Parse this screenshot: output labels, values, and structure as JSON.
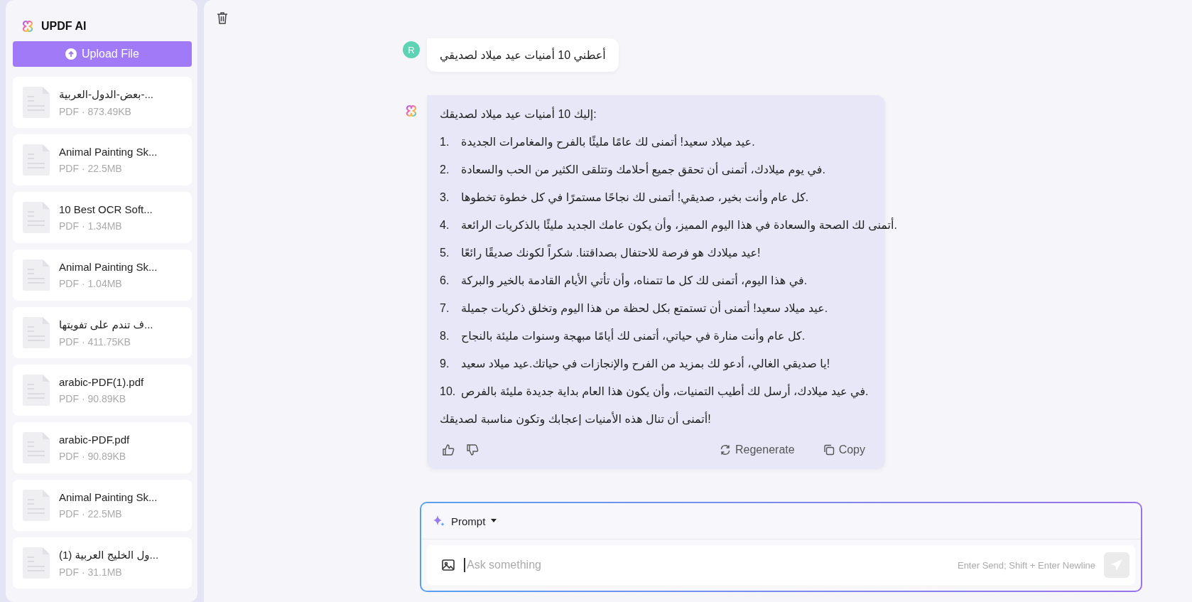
{
  "app": {
    "title": "UPDF AI",
    "upload_button": "Upload File"
  },
  "files": [
    {
      "name": "...-بعض-الدول-العربية",
      "meta": "PDF · 873.49KB"
    },
    {
      "name": "Animal Painting Sk...",
      "meta": "PDF · 22.5MB"
    },
    {
      "name": "10 Best OCR Soft...",
      "meta": "PDF · 1.34MB"
    },
    {
      "name": "Animal Painting Sk...",
      "meta": "PDF · 1.04MB"
    },
    {
      "name": "...ف تندم على تفويتها",
      "meta": "PDF · 411.75KB"
    },
    {
      "name": "arabic-PDF(1).pdf",
      "meta": "PDF · 90.89KB"
    },
    {
      "name": "arabic-PDF.pdf",
      "meta": "PDF · 90.89KB"
    },
    {
      "name": "Animal Painting Sk...",
      "meta": "PDF · 22.5MB"
    },
    {
      "name": "...ول الخليج العربية (1)",
      "meta": "PDF · 31.1MB"
    }
  ],
  "messages": [
    {
      "kind": "user",
      "avatar": "R",
      "text": "أعطني 10 أمنيات عيد ميلاد لصديقي"
    },
    {
      "kind": "assistant",
      "intro": "إليك 10 أمنيات عيد ميلاد لصديقك:",
      "items": [
        {
          "number": "1.",
          "text": "عيد ميلاد سعيد! أتمنى لك عامًا مليئًا بالفرح والمغامرات الجديدة."
        },
        {
          "number": "2.",
          "text": "في يوم ميلادك، أتمنى أن تحقق جميع أحلامك وتتلقى الكثير من الحب والسعادة."
        },
        {
          "number": "3.",
          "text": "كل عام وأنت بخير، صديقي! أتمنى لك نجاحًا مستمرًا في كل خطوة تخطوها."
        },
        {
          "number": "4.",
          "text": "أتمنى لك الصحة والسعادة في هذا اليوم المميز، وأن يكون عامك الجديد مليئًا بالذكريات الرائعة."
        },
        {
          "number": "5.",
          "text": "عيد ميلادك هو فرصة للاحتفال بصداقتنا. شكراً لكونك صديقًا رائعًا!"
        },
        {
          "number": "6.",
          "text": "في هذا اليوم، أتمنى لك كل ما تتمناه، وأن تأتي الأيام القادمة بالخير والبركة."
        },
        {
          "number": "7.",
          "text": "عيد ميلاد سعيد! أتمنى أن تستمتع بكل لحظة من هذا اليوم وتخلق ذكريات جميلة."
        },
        {
          "number": "8.",
          "text": "كل عام وأنت منارة في حياتي، أتمنى لك أيامًا مبهجة وسنوات مليئة بالنجاح."
        },
        {
          "number": "9.",
          "text": "يا صديقي الغالي، أدعو لك بمزيد من الفرح والإنجازات في حياتك.عيد ميلاد سعيد!"
        },
        {
          "number": "10.",
          "text": "في عيد ميلادك، أرسل لك أطيب التمنيات، وأن يكون هذا العام بداية جديدة مليئة بالفرص."
        }
      ],
      "outro": "أتمنى أن تنال هذه الأمنيات إعجابك وتكون مناسبة لصديقك!",
      "actions": {
        "regenerate": "Regenerate",
        "copy": "Copy"
      }
    }
  ],
  "prompt": {
    "mode": "Prompt",
    "placeholder": "Ask something",
    "hint": "Enter Send; Shift + Enter Newline"
  }
}
